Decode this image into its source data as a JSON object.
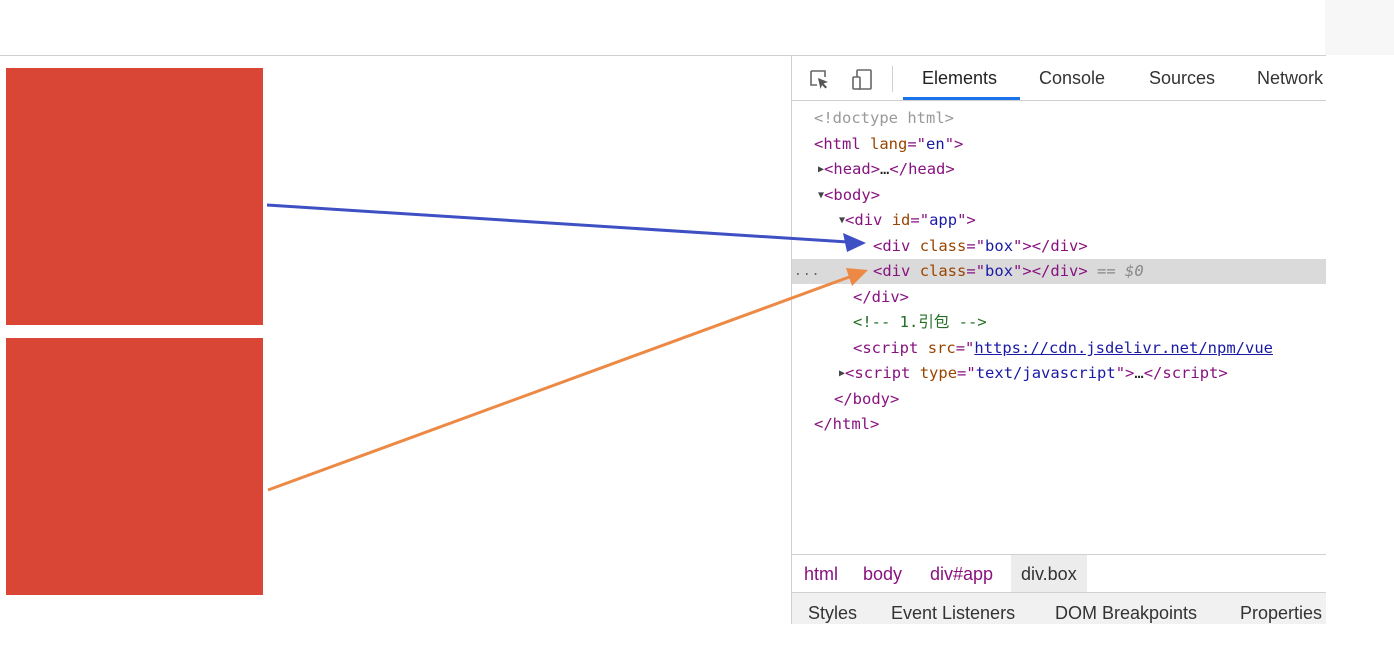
{
  "devtools": {
    "tabs": [
      "Elements",
      "Console",
      "Sources",
      "Network"
    ],
    "active_tab": "Elements",
    "dom": {
      "doctype": "<!doctype html>",
      "html_tag": "html",
      "html_attr": "lang",
      "html_val": "en",
      "head_tag": "head",
      "head_ellipsis": "…",
      "body_tag": "body",
      "div_tag": "div",
      "id_attr": "id",
      "app_val": "app",
      "class_attr": "class",
      "box_val": "box",
      "selected_suffix": "== $0",
      "comment": "<!-- 1.引包 -->",
      "script_tag": "script",
      "src_attr": "src",
      "src_val": "https://cdn.jsdelivr.net/npm/vue",
      "type_attr": "type",
      "type_val": "text/javascript",
      "script_ellipsis": "…",
      "gutter_dots": "..."
    },
    "breadcrumbs": [
      "html",
      "body",
      "div#app",
      "div.box"
    ],
    "subtabs": [
      "Styles",
      "Event Listeners",
      "DOM Breakpoints",
      "Properties"
    ]
  },
  "colors": {
    "box": "#d94636",
    "arrow_blue": "#3f4fc4",
    "arrow_orange": "#ec8a45",
    "accent": "#1a73e8"
  }
}
